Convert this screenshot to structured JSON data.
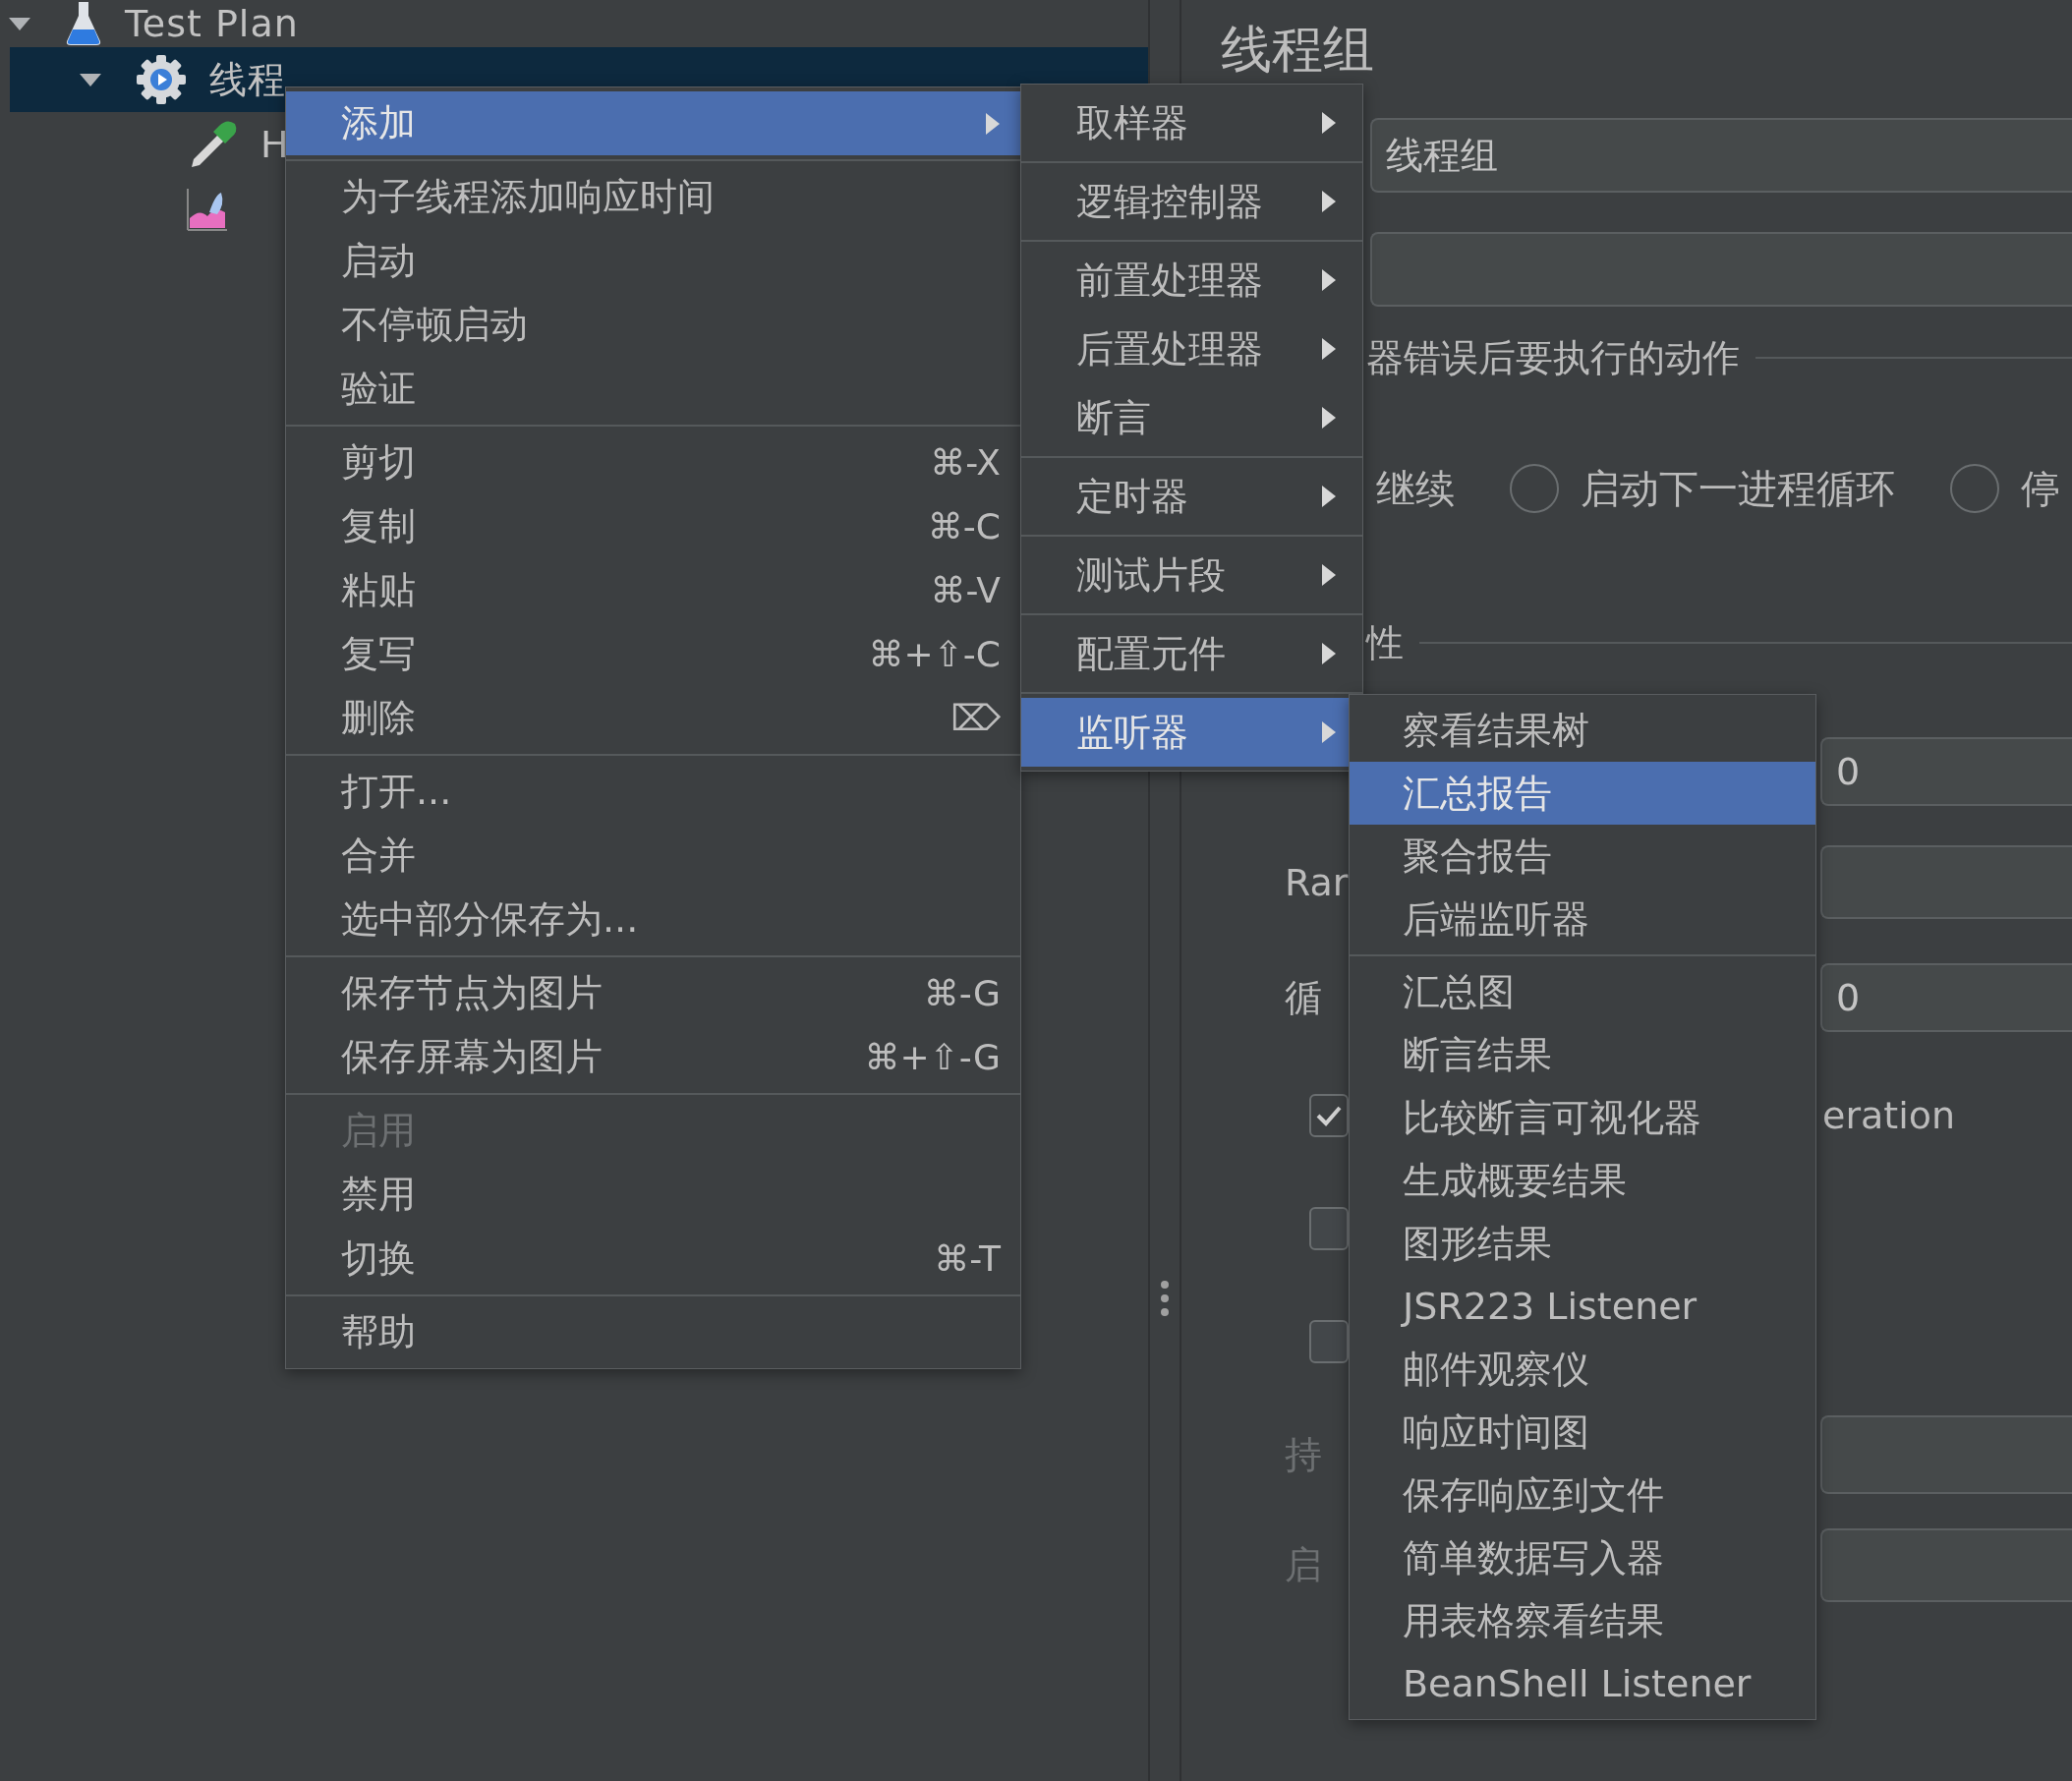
{
  "tree": [
    {
      "label": "Test Plan",
      "kind": "flask",
      "expanded": true,
      "selected": false,
      "children": [
        {
          "label": "线程",
          "kind": "gear",
          "expanded": true,
          "selected": true,
          "children": [
            {
              "label": "H",
              "kind": "pipette",
              "selected": false
            },
            {
              "kind": "chart",
              "selected": false
            }
          ]
        }
      ]
    }
  ],
  "panel": {
    "title": "线程组",
    "name_value": "线程组",
    "error_action": {
      "legend": "器错误后要执行的动作",
      "continue_label": "继续",
      "options": [
        {
          "label": "启动下一进程循环",
          "selected": false
        },
        {
          "label": "停",
          "selected": false
        }
      ]
    },
    "properties": {
      "legend": "性",
      "threads_value": "0",
      "ramp_label": "Rar",
      "loop_label": "循",
      "loop_value": "0",
      "checkboxes": [
        {
          "checked": true,
          "label": "eration"
        },
        {
          "checked": false
        },
        {
          "checked": false
        }
      ],
      "duration": {
        "label": "持",
        "disabled": true
      },
      "delay": {
        "label": "启",
        "disabled": true
      }
    }
  },
  "context_menu": {
    "groups": [
      [
        {
          "label": "添加",
          "selected": true,
          "disabled": false,
          "submenu": true
        }
      ],
      [
        {
          "label": "为子线程添加响应时间",
          "selected": false,
          "disabled": false,
          "submenu": false
        },
        {
          "label": "启动",
          "selected": false,
          "disabled": false,
          "submenu": false
        },
        {
          "label": "不停顿启动",
          "selected": false,
          "disabled": false,
          "submenu": false
        },
        {
          "label": "验证",
          "selected": false,
          "disabled": false,
          "submenu": false
        }
      ],
      [
        {
          "label": "剪切",
          "shortcut": "⌘-X",
          "selected": false,
          "disabled": false,
          "submenu": false
        },
        {
          "label": "复制",
          "shortcut": "⌘-C",
          "selected": false,
          "disabled": false,
          "submenu": false
        },
        {
          "label": "粘贴",
          "shortcut": "⌘-V",
          "selected": false,
          "disabled": false,
          "submenu": false
        },
        {
          "label": "复写",
          "shortcut": "⌘+⇧-C",
          "selected": false,
          "disabled": false,
          "submenu": false
        },
        {
          "label": "删除",
          "shortcut": "⌦",
          "selected": false,
          "disabled": false,
          "submenu": false
        }
      ],
      [
        {
          "label": "打开...",
          "selected": false,
          "disabled": false,
          "submenu": false
        },
        {
          "label": "合并",
          "selected": false,
          "disabled": false,
          "submenu": false
        },
        {
          "label": "选中部分保存为...",
          "selected": false,
          "disabled": false,
          "submenu": false
        }
      ],
      [
        {
          "label": "保存节点为图片",
          "shortcut": "⌘-G",
          "selected": false,
          "disabled": false,
          "submenu": false
        },
        {
          "label": "保存屏幕为图片",
          "shortcut": "⌘+⇧-G",
          "selected": false,
          "disabled": false,
          "submenu": false
        }
      ],
      [
        {
          "label": "启用",
          "selected": false,
          "disabled": true,
          "submenu": false
        },
        {
          "label": "禁用",
          "selected": false,
          "disabled": false,
          "submenu": false
        },
        {
          "label": "切换",
          "shortcut": "⌘-T",
          "selected": false,
          "disabled": false,
          "submenu": false
        }
      ],
      [
        {
          "label": "帮助",
          "selected": false,
          "disabled": false,
          "submenu": false
        }
      ]
    ]
  },
  "add_submenu": {
    "groups": [
      [
        {
          "label": "取样器",
          "selected": false,
          "submenu": true
        }
      ],
      [
        {
          "label": "逻辑控制器",
          "selected": false,
          "submenu": true
        }
      ],
      [
        {
          "label": "前置处理器",
          "selected": false,
          "submenu": true
        },
        {
          "label": "后置处理器",
          "selected": false,
          "submenu": true
        },
        {
          "label": "断言",
          "selected": false,
          "submenu": true
        }
      ],
      [
        {
          "label": "定时器",
          "selected": false,
          "submenu": true
        }
      ],
      [
        {
          "label": "测试片段",
          "selected": false,
          "submenu": true
        }
      ],
      [
        {
          "label": "配置元件",
          "selected": false,
          "submenu": true
        }
      ],
      [
        {
          "label": "监听器",
          "selected": true,
          "submenu": true
        }
      ]
    ]
  },
  "listener_submenu": {
    "groups": [
      [
        {
          "label": "察看结果树",
          "selected": false
        },
        {
          "label": "汇总报告",
          "selected": true
        },
        {
          "label": "聚合报告",
          "selected": false
        },
        {
          "label": "后端监听器",
          "selected": false
        }
      ],
      [
        {
          "label": "汇总图",
          "selected": false
        },
        {
          "label": "断言结果",
          "selected": false
        },
        {
          "label": "比较断言可视化器",
          "selected": false
        },
        {
          "label": "生成概要结果",
          "selected": false
        },
        {
          "label": "图形结果",
          "selected": false
        },
        {
          "label": "JSR223 Listener",
          "selected": false
        },
        {
          "label": "邮件观察仪",
          "selected": false
        },
        {
          "label": "响应时间图",
          "selected": false
        },
        {
          "label": "保存响应到文件",
          "selected": false
        },
        {
          "label": "简单数据写入器",
          "selected": false
        },
        {
          "label": "用表格察看结果",
          "selected": false
        },
        {
          "label": "BeanShell Listener",
          "selected": false
        }
      ]
    ]
  }
}
